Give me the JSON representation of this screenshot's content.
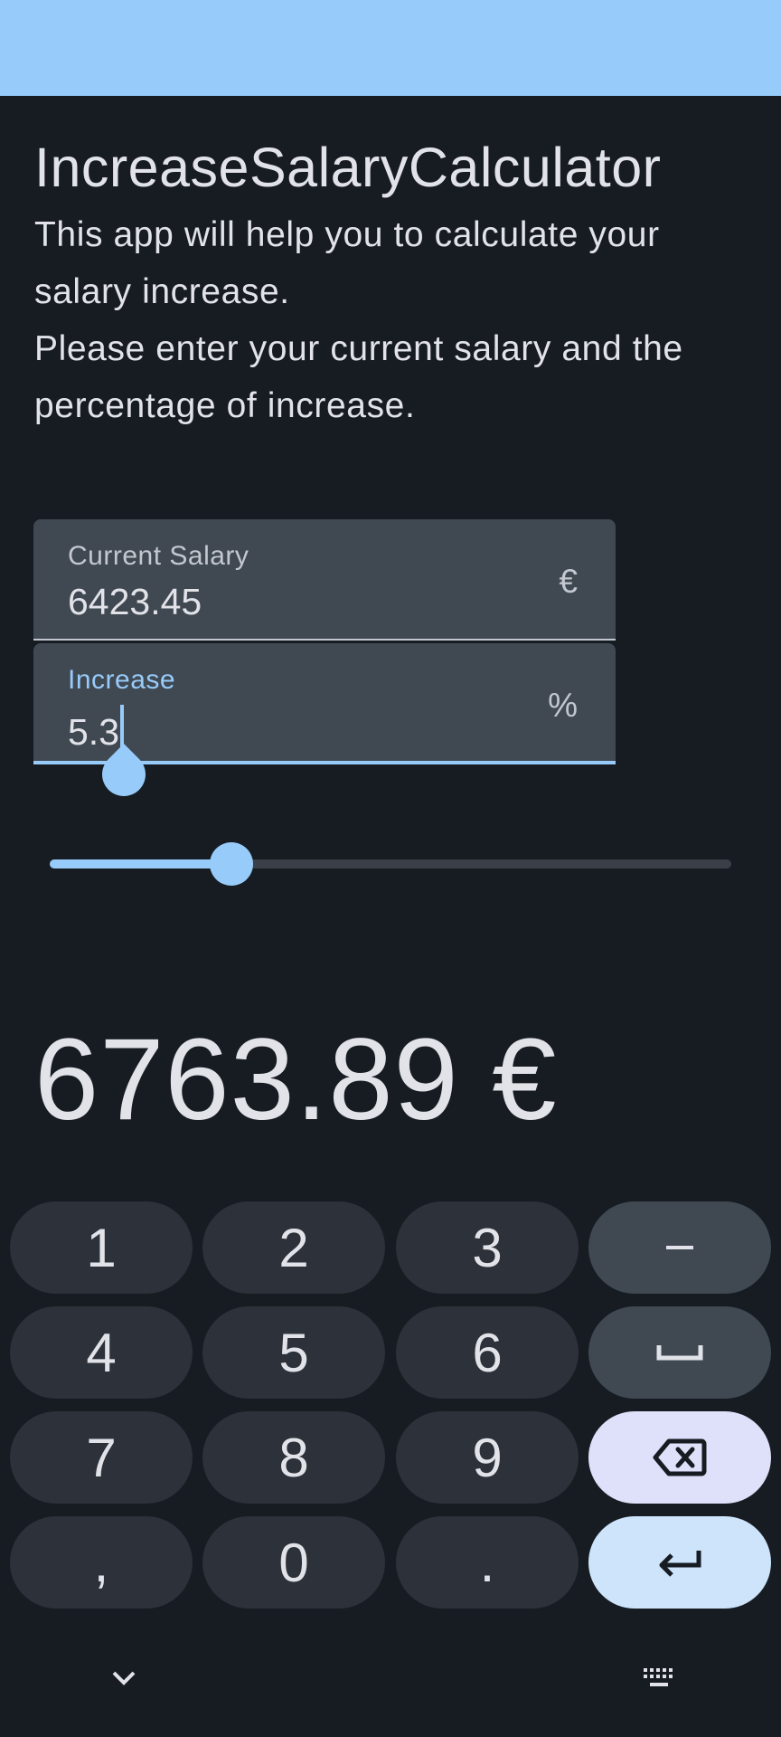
{
  "app": {
    "title": "IncreaseSalaryCalculator",
    "description_line1": "This app will help you to calculate your salary increase.",
    "description_line2": "Please enter your current salary and the percentage of increase."
  },
  "fields": {
    "salary": {
      "label": "Current Salary",
      "value": "6423.45",
      "suffix": "€"
    },
    "increase": {
      "label": "Increase",
      "value": "5.3",
      "suffix": "%"
    }
  },
  "slider": {
    "fraction": 0.267
  },
  "result": {
    "text": "6763.89 €"
  },
  "keyboard": {
    "row1": [
      "1",
      "2",
      "3"
    ],
    "row2": [
      "4",
      "5",
      "6"
    ],
    "row3": [
      "7",
      "8",
      "9"
    ],
    "row4": [
      ",",
      "0",
      "."
    ],
    "func_icons": [
      "minus-icon",
      "space-icon",
      "backspace-icon",
      "enter-icon"
    ]
  },
  "nav": {
    "left_icon": "chevron-down-icon",
    "right_icon": "keyboard-icon"
  },
  "colors": {
    "accent": "#97cbf9",
    "background": "#171c22",
    "field_bg": "#404852"
  }
}
